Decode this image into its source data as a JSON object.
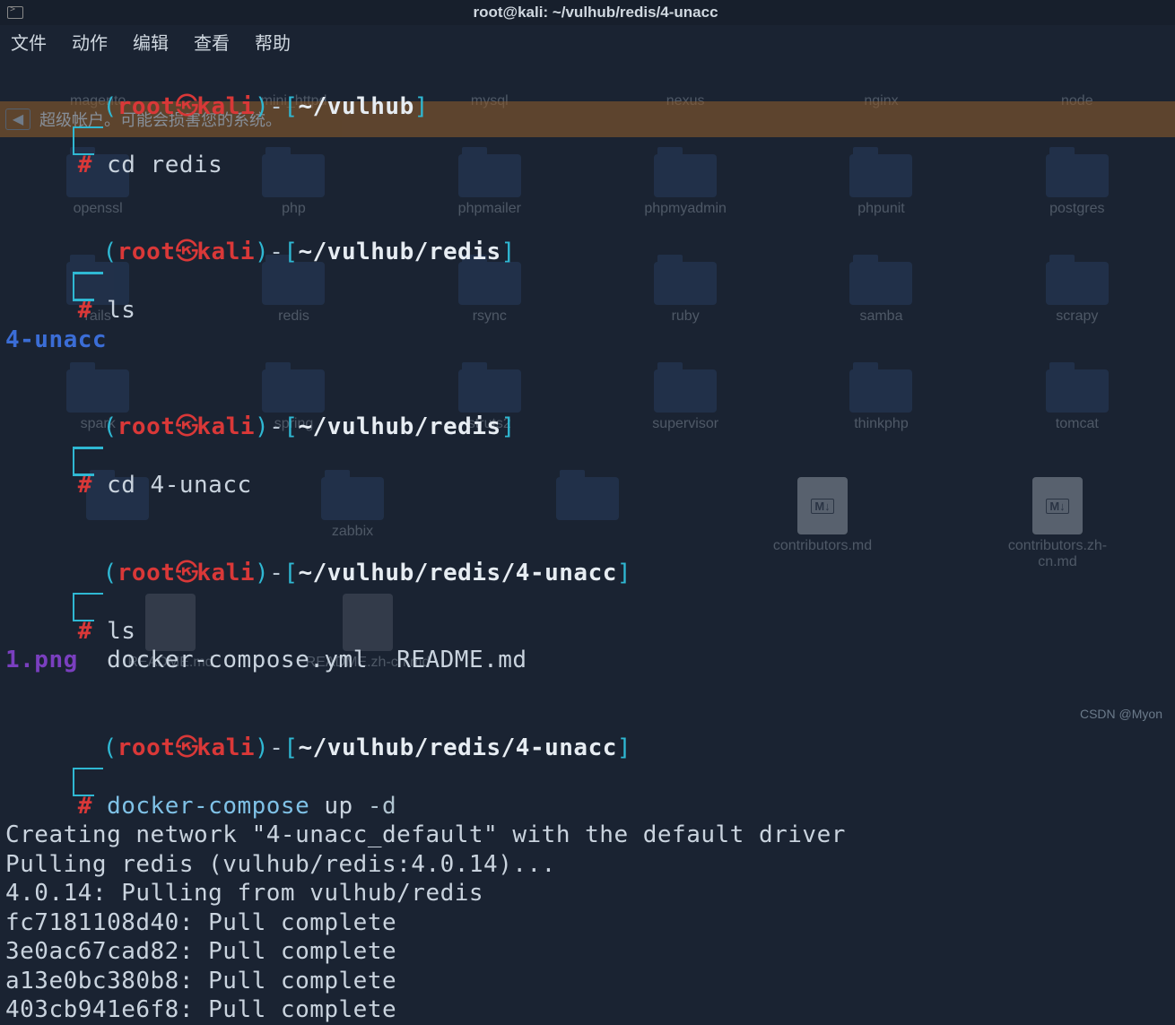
{
  "titlebar": {
    "title": "root@kali: ~/vulhub/redis/4-unacc"
  },
  "menu": {
    "file": "文件",
    "action": "动作",
    "edit": "编辑",
    "view": "查看",
    "help": "帮助"
  },
  "warn": {
    "text": "超级帐户。可能会损害您的系统。"
  },
  "bg": {
    "row1": [
      "magento",
      "mini_httpd",
      "mysql",
      "nexus",
      "nginx",
      "node"
    ],
    "row2": [
      "openssl",
      "php",
      "phpmailer",
      "phpmyadmin",
      "phpunit",
      "postgres"
    ],
    "row3": [
      "rails",
      "redis",
      "rsync",
      "ruby",
      "samba",
      "scrapy"
    ],
    "row4": [
      "spark",
      "spring",
      "struts2",
      "supervisor",
      "thinkphp",
      "tomcat"
    ],
    "row5": [
      "",
      "zabbix",
      "",
      "contributors.md",
      "contributors.zh-cn.md"
    ],
    "row6": [
      "README.md",
      "README.zh-cn.md"
    ]
  },
  "prompts": {
    "user": "root",
    "host": "kali",
    "p1_path": "~/vulhub",
    "p1_cmd": "cd redis",
    "p2_path": "~/vulhub/redis",
    "p2_cmd": "ls",
    "p2_out": "4-unacc",
    "p3_path": "~/vulhub/redis",
    "p3_cmd": "cd 4-unacc",
    "p4_path": "~/vulhub/redis/4-unacc",
    "p4_cmd": "ls",
    "p4_out_img": "1.png",
    "p4_out_f1": "docker-compose.yml",
    "p4_out_f2": "README.md",
    "p5_path": "~/vulhub/redis/4-unacc",
    "p5_cmd": "docker-compose",
    "p5_arg": "up",
    "p5_flag": "-d"
  },
  "output": {
    "l1": "Creating network \"4-unacc_default\" with the default driver",
    "l2": "Pulling redis (vulhub/redis:4.0.14)...",
    "l3": "4.0.14: Pulling from vulhub/redis",
    "l4": "fc7181108d40: Pull complete",
    "l5": "3e0ac67cad82: Pull complete",
    "l6": "a13e0bc380b8: Pull complete",
    "l7": "403cb941e6f8: Pull complete"
  },
  "watermark": "CSDN @Myon⁮"
}
